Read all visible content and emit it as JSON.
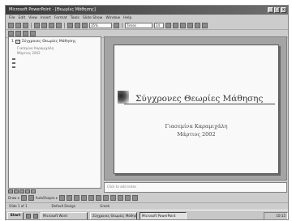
{
  "window": {
    "title": "Microsoft PowerPoint - [Θεωρίες Μάθησης]",
    "controls": [
      "_",
      "□",
      "x"
    ]
  },
  "menu": [
    "File",
    "Edit",
    "View",
    "Insert",
    "Format",
    "Tools",
    "Slide Show",
    "Window",
    "Help"
  ],
  "toolbar": {
    "zoom": "35%",
    "font": "Times",
    "font_size": "24",
    "icons": [
      "new-icon",
      "open-icon",
      "save-icon",
      "print-icon",
      "cut-icon",
      "copy-icon",
      "paste-icon",
      "undo-icon",
      "bold-icon",
      "italic-icon",
      "underline-icon"
    ]
  },
  "outline": {
    "slide_number": "1",
    "title": "Σύγχρονες Θεωρίες Μάθησης",
    "lines": [
      "Γιασεμίνα Καραμιχάλη",
      "Μάρτιος 2002"
    ]
  },
  "slide": {
    "title": "Σύγχρονες Θεωρίες Μάθησης",
    "author": "Γιασεμίνα Καραμιχάλη",
    "date": "Μάρτιος 2002"
  },
  "notes": {
    "placeholder": "Click to add notes"
  },
  "drawing_bar": {
    "draw_label": "Draw ▾",
    "autoshapes_label": "AutoShapes ▾"
  },
  "status": {
    "slide": "Slide 1 of 1",
    "design": "Default Design",
    "language": "Greek"
  },
  "taskbar": {
    "start": "Start",
    "tasks": [
      "Microsoft Word",
      "Σύγχρονες Θεωρίες Μάθησης",
      "Microsoft PowerPoint"
    ],
    "active_index": 2,
    "clock": "10:15"
  }
}
